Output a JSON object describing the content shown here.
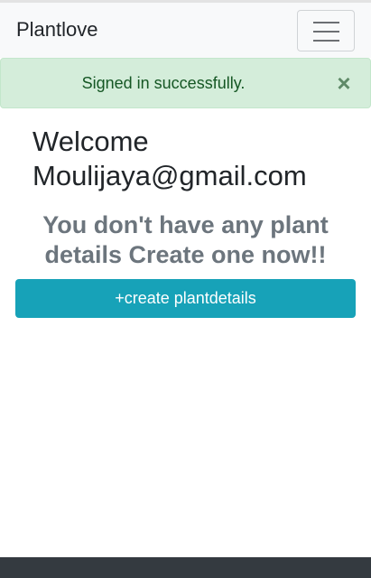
{
  "navbar": {
    "brand": "Plantlove",
    "toggle_icon": "hamburger-icon"
  },
  "alert": {
    "message": "Signed in successfully.",
    "close_symbol": "×",
    "close_icon": "close-icon",
    "color": "#d4edda"
  },
  "main": {
    "welcome_line1": "Welcome",
    "welcome_line2": "Moulijaya@gmail.com",
    "empty_line1": "You don't have any plant",
    "empty_line2": "details Create one now!!",
    "create_button": "+create plantdetails"
  },
  "colors": {
    "accent": "#17a2b8",
    "footer": "#343a40"
  }
}
